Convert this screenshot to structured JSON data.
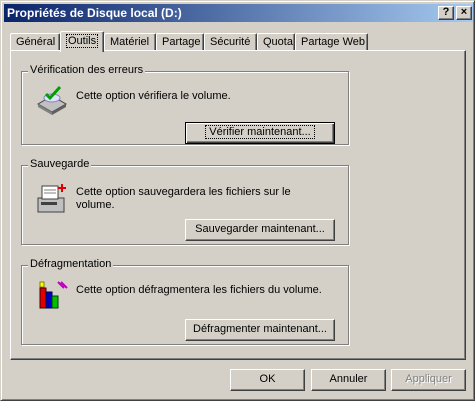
{
  "window": {
    "title": "Propriétés de Disque local (D:)",
    "help_label": "?",
    "close_label": "×"
  },
  "tabs": [
    {
      "label": "Général"
    },
    {
      "label": "Outils"
    },
    {
      "label": "Matériel"
    },
    {
      "label": "Partage"
    },
    {
      "label": "Sécurité"
    },
    {
      "label": "Quota"
    },
    {
      "label": "Partage Web"
    }
  ],
  "active_tab": "Outils",
  "groups": {
    "error_check": {
      "title": "Vérification des erreurs",
      "description": "Cette option vérifiera le volume.",
      "button_label": "Vérifier maintenant..."
    },
    "backup": {
      "title": "Sauvegarde",
      "description": "Cette option sauvegardera les fichiers sur le volume.",
      "button_label": "Sauvegarder maintenant..."
    },
    "defrag": {
      "title": "Défragmentation",
      "description": "Cette option défragmentera les fichiers du volume.",
      "button_label": "Défragmenter maintenant..."
    }
  },
  "footer": {
    "ok_label": "OK",
    "cancel_label": "Annuler",
    "apply_label": "Appliquer"
  },
  "colors": {
    "titlebar_start": "#0a246a",
    "titlebar_end": "#a6caf0",
    "face": "#d4d0c8"
  }
}
